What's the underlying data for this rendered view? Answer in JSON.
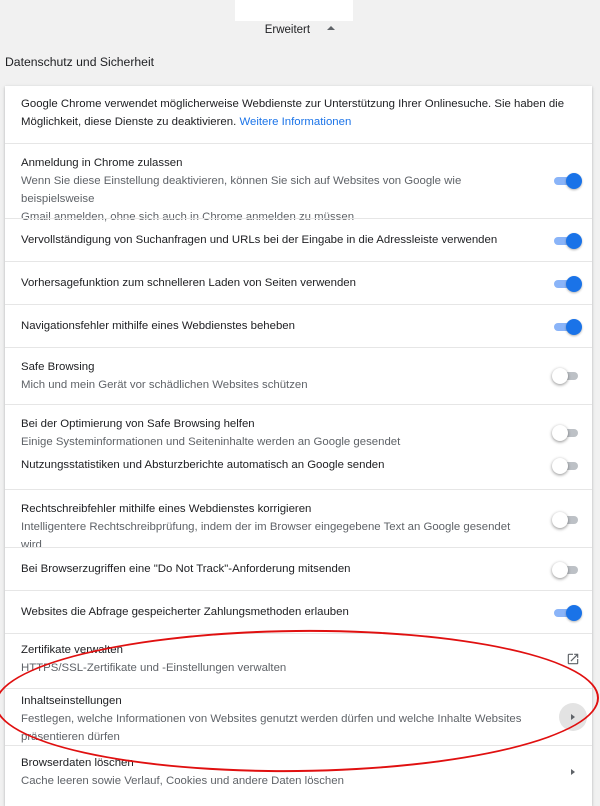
{
  "advanced": {
    "label": "Erweitert"
  },
  "section": {
    "title": "Datenschutz und Sicherheit"
  },
  "intro": {
    "text": "Google Chrome verwendet möglicherweise Webdienste zur Unterstützung Ihrer Onlinesuche. Sie haben die Möglichkeit, diese Dienste zu deaktivieren.",
    "link": "Weitere Informationen"
  },
  "settings": [
    {
      "title": "Anmeldung in Chrome zulassen",
      "desc_line1": "Wenn Sie diese Einstellung deaktivieren, können Sie sich auf Websites von Google wie beispielsweise",
      "desc_line2": "Gmail anmelden, ohne sich auch in Chrome anmelden zu müssen",
      "state": "on"
    },
    {
      "title": "Vervollständigung von Suchanfragen und URLs bei der Eingabe in die Adressleiste verwenden",
      "state": "on"
    },
    {
      "title": "Vorhersagefunktion zum schnelleren Laden von Seiten verwenden",
      "state": "on"
    },
    {
      "title": "Navigationsfehler mithilfe eines Webdienstes beheben",
      "state": "on"
    },
    {
      "title": "Safe Browsing",
      "desc": "Mich und mein Gerät vor schädlichen Websites schützen",
      "state": "off"
    },
    {
      "title": "Bei der Optimierung von Safe Browsing helfen",
      "desc": "Einige Systeminformationen und Seiteninhalte werden an Google gesendet",
      "state": "off"
    },
    {
      "title": "Nutzungsstatistiken und Absturzberichte automatisch an Google senden",
      "state": "off"
    },
    {
      "title": "Rechtschreibfehler mithilfe eines Webdienstes korrigieren",
      "desc": "Intelligentere Rechtschreibprüfung, indem der im Browser eingegebene Text an Google gesendet wird",
      "state": "off"
    },
    {
      "title": "Bei Browserzugriffen eine \"Do Not Track\"-Anforderung mitsenden",
      "state": "off"
    },
    {
      "title": "Websites die Abfrage gespeicherter Zahlungsmethoden erlauben",
      "state": "on"
    }
  ],
  "certificates": {
    "title": "Zertifikate verwalten",
    "desc": "HTTPS/SSL-Zertifikate und -Einstellungen verwalten",
    "icon": "open-in-new-icon"
  },
  "content_settings": {
    "title": "Inhaltseinstellungen",
    "desc_line1": "Festlegen, welche Informationen von Websites genutzt werden dürfen und welche Inhalte Websites",
    "desc_line2": "präsentieren dürfen"
  },
  "clear_data": {
    "title": "Browserdaten löschen",
    "desc": "Cache leeren sowie Verlauf, Cookies und andere Daten löschen"
  },
  "colors": {
    "accent": "#1a73e8",
    "annotation": "#e01010"
  }
}
